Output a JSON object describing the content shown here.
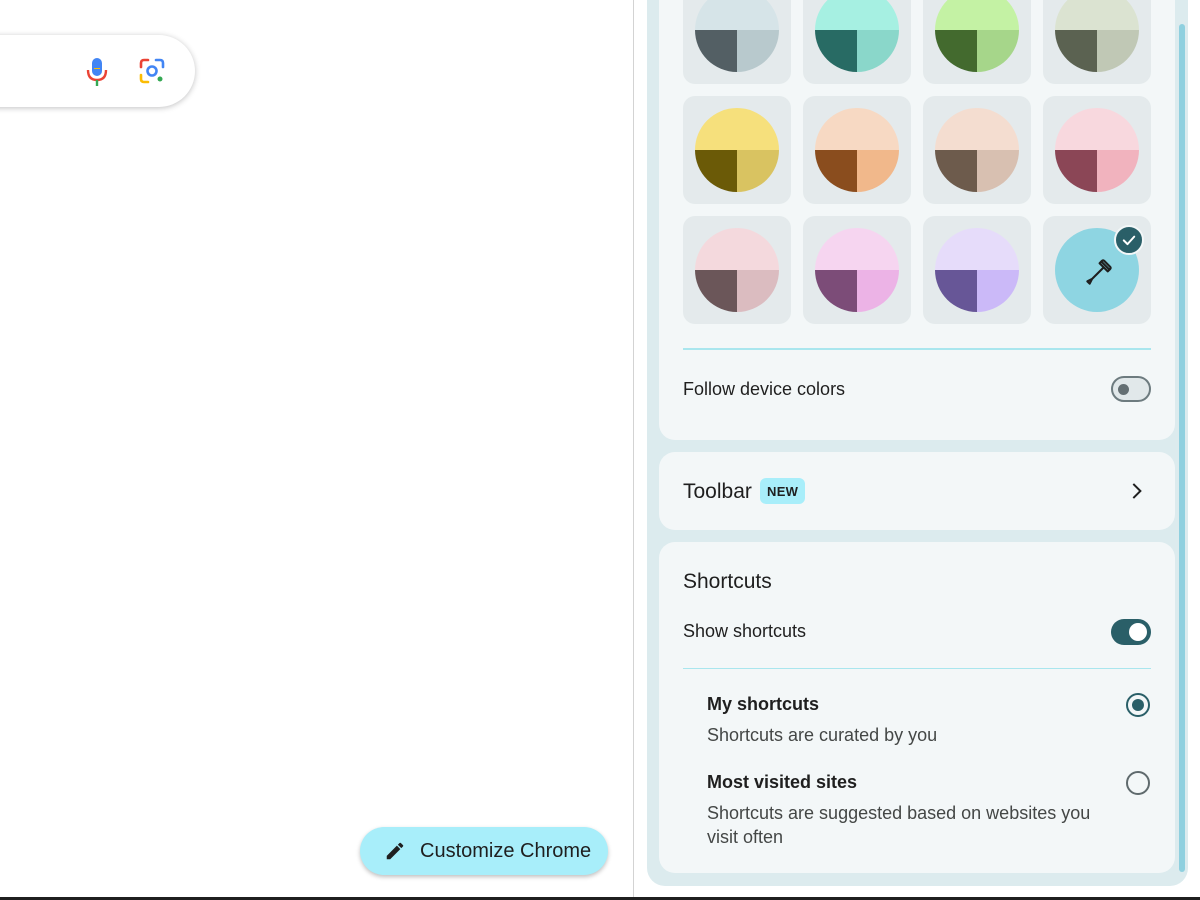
{
  "colors": {
    "accent": "#2a5f68",
    "new_badge": "#a8eefa",
    "panel_bg": "#dcebee",
    "card_bg": "#f3f7f8"
  },
  "ntp": {
    "customize_label": "Customize Chrome",
    "icons": [
      "mic-icon",
      "google-lens-icon",
      "pencil-icon"
    ]
  },
  "theme_swatches": [
    {
      "name": "grey",
      "top": "#d6e4e8",
      "bl": "#535f64",
      "br": "#b8c9cd"
    },
    {
      "name": "aqua",
      "top": "#a6f0e2",
      "bl": "#286b64",
      "br": "#8ad7ca"
    },
    {
      "name": "green",
      "top": "#c4f2a4",
      "bl": "#436a2e",
      "br": "#a6d68a"
    },
    {
      "name": "olive",
      "top": "#dbe3d1",
      "bl": "#5b6251",
      "br": "#c0c8b5"
    },
    {
      "name": "yellow",
      "top": "#f6e07c",
      "bl": "#6b5a07",
      "br": "#d9c361"
    },
    {
      "name": "orange",
      "top": "#f7d9c3",
      "bl": "#8a4d1e",
      "br": "#f1b88b"
    },
    {
      "name": "peach",
      "top": "#f4ddd0",
      "bl": "#6d5b4c",
      "br": "#d8c0b1"
    },
    {
      "name": "pink",
      "top": "#f8d8de",
      "bl": "#8b4656",
      "br": "#f1b3be"
    },
    {
      "name": "rose",
      "top": "#f4d9dd",
      "bl": "#6b5659",
      "br": "#dbbcc0"
    },
    {
      "name": "magenta",
      "top": "#f6d5f0",
      "bl": "#7c4c78",
      "br": "#ecb3e6"
    },
    {
      "name": "lavender",
      "top": "#e6dcfa",
      "bl": "#675697",
      "br": "#cbb9f8"
    },
    {
      "name": "custom",
      "top": "#8ed5e2",
      "bl": "#8ed5e2",
      "br": "#8ed5e2"
    }
  ],
  "selected_swatch": "custom",
  "follow_device": {
    "label": "Follow device colors",
    "enabled": false
  },
  "toolbar": {
    "label": "Toolbar",
    "badge": "NEW"
  },
  "shortcuts": {
    "title": "Shortcuts",
    "show_label": "Show shortcuts",
    "show_enabled": true,
    "options": [
      {
        "title": "My shortcuts",
        "desc": "Shortcuts are curated by you",
        "selected": true
      },
      {
        "title": "Most visited sites",
        "desc": "Shortcuts are suggested based on websites you visit often",
        "selected": false
      }
    ]
  }
}
